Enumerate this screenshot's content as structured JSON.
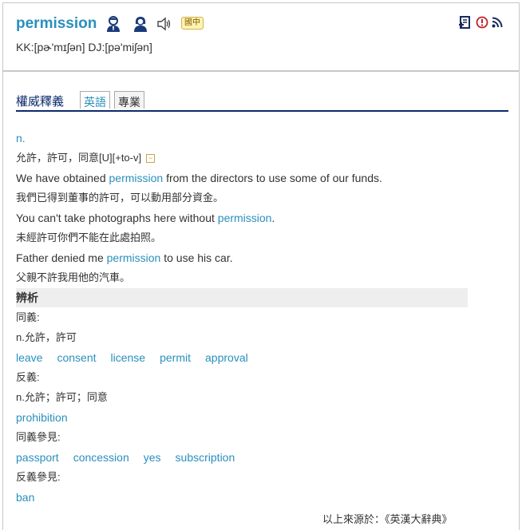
{
  "entry": {
    "word": "permission",
    "badge": "國中",
    "phonetic": "KK:[pɚ'mɪʃən] DJ:[pə'miʃən]"
  },
  "tabs": {
    "section_title": "權威釋義",
    "items": [
      {
        "label": "英語",
        "active": true
      },
      {
        "label": "專業",
        "active": false
      }
    ]
  },
  "definition": {
    "pos": "n.",
    "meaning": "允許，許可，同意[U][+to-v]",
    "collapse_symbol": "−",
    "examples": [
      {
        "before": "We have obtained ",
        "highlight": "permission",
        "after": " from the directors to use some of our funds.",
        "zh": "我們已得到董事的許可，可以動用部分資金。"
      },
      {
        "before": "You can't take photographs here without ",
        "highlight": "permission",
        "after": ".",
        "zh": "未經許可你們不能在此處拍照。"
      },
      {
        "before": "Father denied me ",
        "highlight": "permission",
        "after": " to use his car.",
        "zh": "父親不許我用他的汽車。"
      }
    ]
  },
  "analysis": {
    "heading": "辨析",
    "synonyms_label": "同義:",
    "synonyms_pos": "n.允許，許可",
    "synonyms": [
      "leave",
      "consent",
      "license",
      "permit",
      "approval"
    ],
    "antonyms_label": "反義:",
    "antonyms_pos": "n.允許；許可；同意",
    "antonyms": [
      "prohibition"
    ],
    "see_synonyms_label": "同義參見:",
    "see_synonyms": [
      "passport",
      "concession",
      "yes",
      "subscription"
    ],
    "see_antonyms_label": "反義參見:",
    "see_antonyms": [
      "ban"
    ]
  },
  "source": "以上來源於：《英漢大辭典》"
}
